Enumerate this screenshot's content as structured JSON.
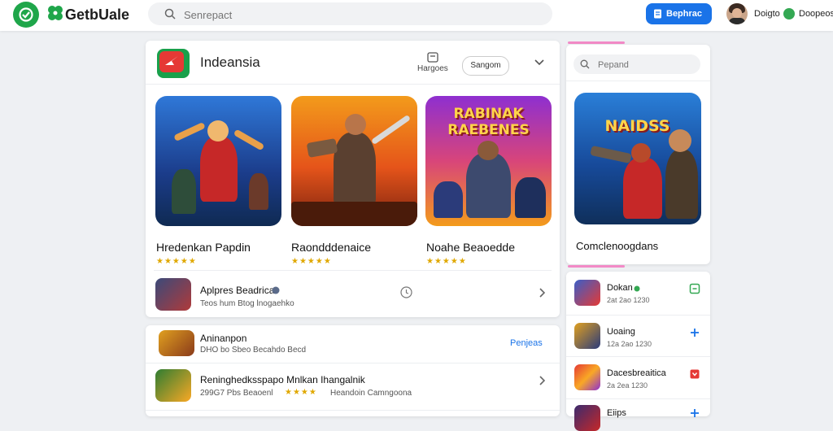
{
  "topbar": {
    "brand": "GetbUale",
    "search_placeholder": "Senrepact",
    "install_label": "Bephrac",
    "user_name": "Doigto",
    "help_label": "Doopeos"
  },
  "main": {
    "app_title": "Indeansia",
    "manage_label": "Hargoes",
    "sort_label": "Sangom",
    "featured": [
      {
        "name": "Hredenkan Papdin",
        "stars": "★★★★★",
        "art_title": ""
      },
      {
        "name": "Raondddenaice",
        "stars": "★★★★★",
        "art_title": ""
      },
      {
        "name": "Noahe Beaoedde",
        "stars": "★★★★★",
        "art_title": "RABINAK RAEBENES"
      }
    ],
    "rows": [
      {
        "title": "Aplpres Beadrica",
        "sub": "Teos hum Btog lnogaehko"
      },
      {
        "title": "Aninanpon",
        "sub": "DHO bo Sbeo Becahdo Becd",
        "action": "Penjeas"
      },
      {
        "title": "Reninghedksspapo Mnlkan Ihangalnik",
        "sub": "299G7  Pbs Beaoenl",
        "stars": "★★★★",
        "sub2": "Heandoin Camngoona"
      }
    ]
  },
  "side": {
    "search_placeholder": "Pepand",
    "featured_art_title": "NAIDSS",
    "featured_name": "Comclenoogdans",
    "list": [
      {
        "title": "Dokan",
        "sub": "2at 2ao 1230"
      },
      {
        "title": "Uoaing",
        "sub": "12a 2ao 1230"
      },
      {
        "title": "Dacesbreaitica",
        "sub": "2a 2ea 1230"
      },
      {
        "title": "Eiips",
        "sub": ""
      }
    ]
  },
  "colors": {
    "accent": "#1a73e8",
    "brand_green": "#1fa64a",
    "star": "#e0a800",
    "pink_tab": "#f28ac7"
  }
}
